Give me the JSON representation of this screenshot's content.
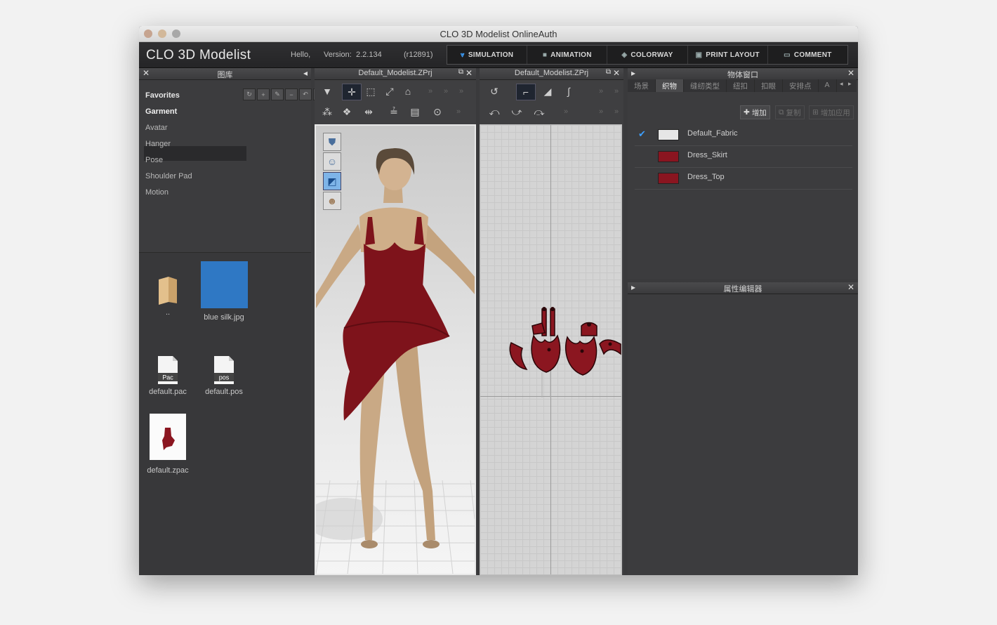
{
  "window": {
    "title": "CLO 3D Modelist OnlineAuth"
  },
  "header": {
    "logo": "CLO 3D Modelist",
    "hello": "Hello,",
    "version_label": "Version:",
    "version": "2.2.134",
    "build": "(r12891)"
  },
  "modes": [
    {
      "label": "SIMULATION",
      "icon": "simulation-icon",
      "active": true
    },
    {
      "label": "ANIMATION",
      "icon": "camera-icon",
      "active": false
    },
    {
      "label": "COLORWAY",
      "icon": "colorway-icon",
      "active": false
    },
    {
      "label": "PRINT LAYOUT",
      "icon": "printer-icon",
      "active": false
    },
    {
      "label": "COMMENT",
      "icon": "comment-icon",
      "active": false
    }
  ],
  "library": {
    "title": "图库",
    "items": [
      "Favorites",
      "Garment",
      "Avatar",
      "Hanger",
      "Pose",
      "Shoulder Pad",
      "Motion"
    ],
    "selected": "Garment",
    "files": [
      {
        "name": "..",
        "icon": "folder-icon"
      },
      {
        "name": "blue silk.jpg",
        "icon": "image-thumbnail"
      },
      {
        "name": "default.pac",
        "icon": "pac-file-icon",
        "badge": "Pac"
      },
      {
        "name": "default.pos",
        "icon": "pos-file-icon",
        "badge": "pos"
      },
      {
        "name": "default.zpac",
        "icon": "garment-thumbnail"
      }
    ],
    "colors": {
      "blue_silk": "#2f78c4",
      "garment": "#8b1620"
    }
  },
  "view3d": {
    "title": "Default_Modelist.ZPrj"
  },
  "view2d": {
    "title": "Default_Modelist.ZPrj"
  },
  "object_browser": {
    "title": "物体窗口",
    "tabs": [
      "场景",
      "织物",
      "缝纫类型",
      "纽扣",
      "扣眼",
      "安排点",
      "A"
    ],
    "active_tab": "织物",
    "buttons": {
      "add": "增加",
      "copy": "复制",
      "apply": "增加应用"
    },
    "fabrics": [
      {
        "name": "Default_Fabric",
        "color": "#e6e6e6",
        "checked": true
      },
      {
        "name": "Dress_Skirt",
        "color": "#8a1520",
        "checked": false
      },
      {
        "name": "Dress_Top",
        "color": "#8a1520",
        "checked": false
      }
    ]
  },
  "property_editor": {
    "title": "属性编辑器"
  }
}
